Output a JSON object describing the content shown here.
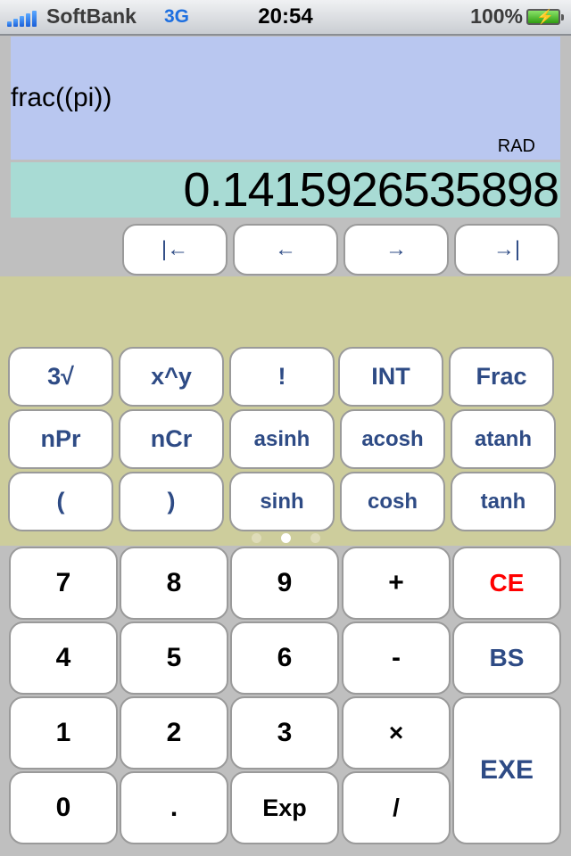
{
  "status_bar": {
    "carrier": "SoftBank",
    "network": "3G",
    "time": "20:54",
    "battery_percent": "100%",
    "battery_icon": "charging-bolt"
  },
  "display": {
    "expression": "frac((pi))",
    "angle_mode": "RAD",
    "result": "0.1415926535898"
  },
  "cursor_buttons": [
    {
      "label": "|←",
      "name": "cursor-home-button"
    },
    {
      "label": "←",
      "name": "cursor-left-button"
    },
    {
      "label": "→",
      "name": "cursor-right-button"
    },
    {
      "label": "→|",
      "name": "cursor-end-button"
    }
  ],
  "function_keys": {
    "row1": [
      "3√",
      "x^y",
      "!",
      "INT",
      "Frac"
    ],
    "row2": [
      "nPr",
      "nCr",
      "asinh",
      "acosh",
      "atanh"
    ],
    "row3": [
      "(",
      ")",
      "sinh",
      "cosh",
      "tanh"
    ]
  },
  "page_indicator": {
    "pages": 3,
    "current": 2
  },
  "keypad": {
    "row1": [
      "7",
      "8",
      "9",
      "+",
      "CE"
    ],
    "row2": [
      "4",
      "5",
      "6",
      "-",
      "BS"
    ],
    "row3": [
      "1",
      "2",
      "3",
      "×"
    ],
    "row4": [
      "0",
      ".",
      "Exp",
      "/"
    ],
    "exe": "EXE"
  },
  "colors": {
    "expression_bg": "#b9c7f0",
    "result_bg": "#a8dbd4",
    "function_panel_bg": "#cdcd9c",
    "key_label_blue": "#2e4b85",
    "clear_red": "#ff0000"
  }
}
